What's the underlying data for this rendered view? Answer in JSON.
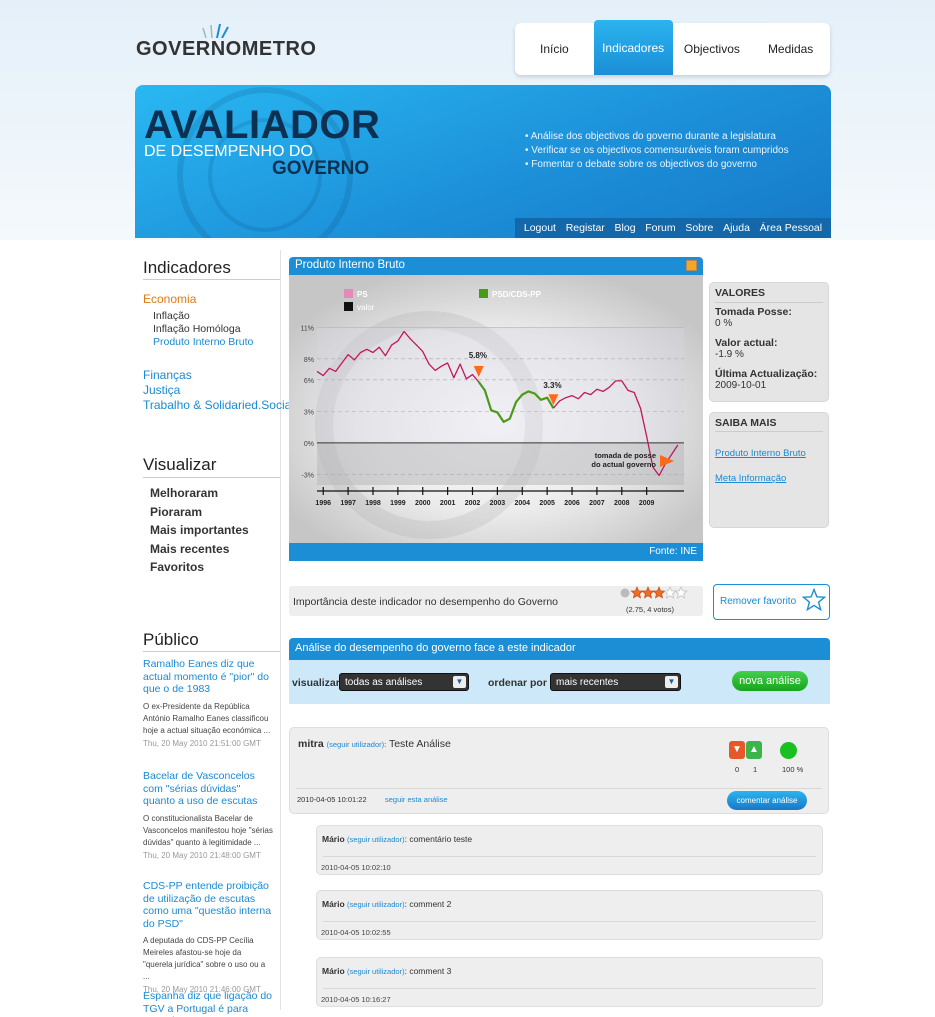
{
  "header": {
    "logo": "GOVERNOMETRO",
    "nav": [
      "Início",
      "Indicadores",
      "Objectivos",
      "Medidas"
    ],
    "nav_active": "Indicadores"
  },
  "banner": {
    "title_line1": "AVALIADOR",
    "title_line2": "DE DESEMPENHO DO",
    "title_line3": "GOVERNO",
    "bullets": [
      "• Análise dos objectivos do governo durante a legislatura",
      "• Verificar se os objectivos comensuráveis foram cumpridos",
      "• Fomentar o debate sobre os objectivos do governo"
    ],
    "subnav": [
      "Logout",
      "Registar",
      "Blog",
      "Forum",
      "Sobre",
      "Ajuda",
      "Área Pessoal"
    ]
  },
  "sidebar": {
    "indicadores_title": "Indicadores",
    "economia": "Economia",
    "economia_sub": [
      "Inflação",
      "Inflação Homóloga",
      "Produto Interno Bruto"
    ],
    "others": [
      "Finanças",
      "Justiça",
      "Trabalho & Solidaried.Social"
    ],
    "visualizar_title": "Visualizar",
    "visualizar": [
      "Melhoraram",
      "Pioraram",
      "Mais importantes",
      "Mais recentes",
      "Favoritos"
    ],
    "publico_title": "Público",
    "news": [
      {
        "title": "Ramalho Eanes diz que actual momento é \"pior\" do que o de 1983",
        "body": "O ex-Presidente da República António Ramalho Eanes classificou hoje a actual situação económica ...",
        "date": "Thu, 20 May 2010 21:51:00 GMT"
      },
      {
        "title": "Bacelar de Vasconcelos com \"sérias dúvidas\" quanto a uso de escutas",
        "body": "O constitucionalista Bacelar de Vasconcelos manifestou hoje \"sérias dúvidas\" quanto à legitimidade ...",
        "date": "Thu, 20 May 2010 21:48:00 GMT"
      },
      {
        "title": "CDS-PP entende proibição de utilização de escutas como uma \"questão interna do PSD\"",
        "body": "A deputada do CDS-PP Cecília Meireles afastou-se hoje da \"querela jurídica\" sobre o uso ou a ...",
        "date": "Thu, 20 May 2010 21:46:00 GMT"
      },
      {
        "title": "Espanha diz que ligação do TGV a Portugal é para cumprir",
        "body": "",
        "date": ""
      }
    ]
  },
  "chart_panel": {
    "title": "Produto Interno Bruto",
    "source": "Fonte: INE"
  },
  "chart_data": {
    "type": "line",
    "legend": [
      "PS",
      "PSD/CDS-PP",
      "valor"
    ],
    "y_ticks": [
      "11%",
      "8%",
      "6%",
      "3%",
      "0%",
      "-3%"
    ],
    "ylim": [
      -4,
      11.5
    ],
    "x_ticks": [
      "1996",
      "1997",
      "1998",
      "1999",
      "2000",
      "2001",
      "2002",
      "2003",
      "2004",
      "2005",
      "2006",
      "2007",
      "2008",
      "2009"
    ],
    "annotations": [
      "5.8%",
      "3.3%",
      "tomada de posse",
      "do actual governo"
    ],
    "series": [
      {
        "name": "PS",
        "color": "#c2185b",
        "x": [
          1995.75,
          1996,
          1996.25,
          1996.5,
          1996.75,
          1997,
          1997.25,
          1997.5,
          1997.75,
          1998,
          1998.25,
          1998.5,
          1998.75,
          1999,
          1999.25,
          1999.5,
          1999.75,
          2000,
          2000.25,
          2000.5,
          2000.75,
          2001,
          2001.25,
          2001.5,
          2001.75,
          2002,
          2002.25
        ],
        "y": [
          6.8,
          6.4,
          7.1,
          6.8,
          7.6,
          8.4,
          7.9,
          8.6,
          8.9,
          8.6,
          9.1,
          8.3,
          9.3,
          9.7,
          10.6,
          9.9,
          9.3,
          8.7,
          7.5,
          6.9,
          7.3,
          7.6,
          6.2,
          7.5,
          6.1,
          6.5,
          5.8
        ]
      },
      {
        "name": "PSD/CDS-PP",
        "color": "#4a9a1a",
        "x": [
          2002.25,
          2002.5,
          2002.75,
          2003,
          2003.25,
          2003.5,
          2003.75,
          2004,
          2004.25,
          2004.5,
          2004.75,
          2005,
          2005.25
        ],
        "y": [
          5.8,
          5.0,
          3.1,
          2.9,
          2.0,
          2.3,
          3.9,
          4.6,
          4.9,
          4.7,
          4.1,
          4.3,
          3.3
        ]
      },
      {
        "name": "PS",
        "color": "#c2185b",
        "x": [
          2005.25,
          2005.5,
          2005.75,
          2006,
          2006.25,
          2006.5,
          2006.75,
          2007,
          2007.25,
          2007.5,
          2007.75,
          2008,
          2008.25,
          2008.5,
          2008.75,
          2009,
          2009.25,
          2009.5,
          2009.75,
          2010,
          2010.25
        ],
        "y": [
          3.3,
          4.0,
          4.3,
          4.5,
          4.2,
          4.8,
          4.6,
          5.1,
          4.9,
          5.3,
          5.9,
          5.9,
          5.0,
          4.8,
          3.3,
          0.6,
          -2.3,
          -3.1,
          -2.0,
          -1.1,
          -0.2
        ]
      }
    ]
  },
  "valores": {
    "title": "VALORES",
    "tomada_label": "Tomada Posse:",
    "tomada_value": "0 %",
    "actual_label": "Valor actual:",
    "actual_value": "-1.9 %",
    "ultima_label": "Última Actualização:",
    "ultima_value": "2009-10-01"
  },
  "saiba": {
    "title": "SAIBA MAIS",
    "links": [
      "Produto Interno Bruto",
      "Meta Informação"
    ]
  },
  "importancia": {
    "text": "Importância deste indicador no desempenho do Governo",
    "rating": 2.75,
    "votes": "(2.75, 4 votos)",
    "favorite": "Remover favorito"
  },
  "analise": {
    "title": "Análise do desempenho do governo face a este indicador",
    "visualizar_label": "visualizar",
    "visualizar_value": "todas as análises",
    "ordenar_label": "ordenar por",
    "ordenar_value": "mais recentes",
    "nova": "nova análise",
    "post": {
      "user": "mitra",
      "follow": "(seguir utilizador)",
      "text": "Teste Análise",
      "down": "0",
      "up": "1",
      "pct": "100 %",
      "date": "2010-04-05 10:01:22",
      "follow_analysis": "seguir esta análise",
      "comment_btn": "comentar análise"
    },
    "comments": [
      {
        "user": "Mário",
        "follow": "(seguir utilizador)",
        "text": "comentário teste",
        "date": "2010-04-05 10:02:10"
      },
      {
        "user": "Mário",
        "follow": "(seguir utilizador)",
        "text": "comment 2",
        "date": "2010-04-05 10:02:55"
      },
      {
        "user": "Mário",
        "follow": "(seguir utilizador)",
        "text": "comment 3",
        "date": "2010-04-05 10:16:27"
      }
    ]
  }
}
